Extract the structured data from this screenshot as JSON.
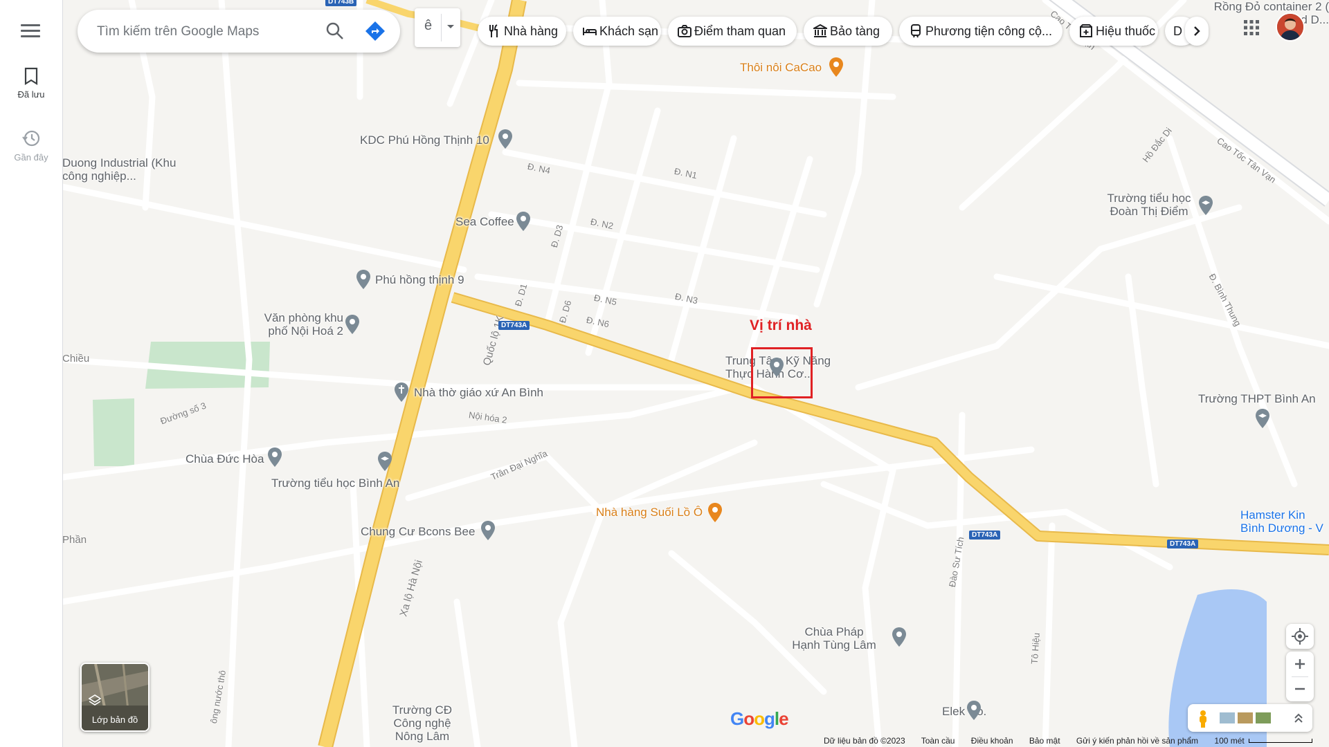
{
  "sidebar": {
    "items": [
      {
        "label": "Đã lưu"
      },
      {
        "label": "Gần đây"
      }
    ]
  },
  "search": {
    "placeholder": "Tìm kiếm trên Google Maps"
  },
  "language_button": {
    "label": "ê"
  },
  "chips": [
    {
      "label": "Nhà hàng"
    },
    {
      "label": "Khách sạn"
    },
    {
      "label": "Điểm tham quan"
    },
    {
      "label": "Bảo tàng"
    },
    {
      "label": "Phương tiện công cộ..."
    },
    {
      "label": "Hiệu thuốc"
    },
    {
      "label": "D"
    }
  ],
  "annotation": {
    "label": "Vị trí nhà",
    "color": "#e02124"
  },
  "places": [
    {
      "name": "Thôi nôi CaCao"
    },
    {
      "name": "KDC Phú Hồng Thịnh 10"
    },
    {
      "name": "Sea Coffee"
    },
    {
      "name": "Phú hồng thịnh 9"
    },
    {
      "name": "Văn phòng khu phố Nội Hoá 2"
    },
    {
      "name": "Nhà thờ giáo xứ An Bình"
    },
    {
      "name": "Chùa Đức Hòa"
    },
    {
      "name": "Trường tiểu học Bình An"
    },
    {
      "name": "Chung Cư Bcons Bee"
    },
    {
      "name": "Nhà hàng Suối Lồ Ô"
    },
    {
      "name": "Trung Tâm Kỹ Năng Thực Hành Cơ..."
    },
    {
      "name": "Trường tiểu học Đoàn Thị Điểm"
    },
    {
      "name": "Trường THPT Bình An"
    },
    {
      "name": "Hamster Kin Bình Dương - V"
    },
    {
      "name": "Chùa Pháp Hạnh Tùng Lâm"
    },
    {
      "name": "Elek Co."
    },
    {
      "name": "Trường CĐ Công nghệ Nông Lâm"
    },
    {
      "name": "Duong Industrial (Khu công nghiệp..."
    },
    {
      "name": "Rồng Đỏ container 2 ( Red D..."
    }
  ],
  "roads": [
    {
      "name": "Quốc lộ 1K"
    },
    {
      "name": "Xa lộ Hà Nội"
    },
    {
      "name": "Đ. N4"
    },
    {
      "name": "Đ. N1"
    },
    {
      "name": "Đ. N2"
    },
    {
      "name": "Đ. D3"
    },
    {
      "name": "Đ. D1"
    },
    {
      "name": "Đ. D6"
    },
    {
      "name": "Đ. N5"
    },
    {
      "name": "Đ. N6"
    },
    {
      "name": "Đ. N3"
    },
    {
      "name": "Nội hóa 2"
    },
    {
      "name": "Trần Đại Nghĩa"
    },
    {
      "name": "Đường số 3"
    },
    {
      "name": "Đào Sư Tích"
    },
    {
      "name": "Tô Hiệu"
    },
    {
      "name": "Hồ Đắc Di"
    },
    {
      "name": "Đ. Bình Thung"
    },
    {
      "name": "Cao Tốc Tân Vạn"
    },
    {
      "name": "Cao Tố... Vạn"
    },
    {
      "name": "Chiều"
    },
    {
      "name": "Phần"
    },
    {
      "name": "ông nước thô"
    }
  ],
  "route_shields": [
    "DT743A",
    "DT743A",
    "DT743A",
    "DT743B"
  ],
  "layers": {
    "label": "Lớp bản đồ"
  },
  "footer": {
    "data": "Dữ liệu bản đồ ©2023",
    "links": [
      "Toàn cầu",
      "Điều khoản",
      "Bảo mật",
      "Gửi ý kiến phản hồi về sản phẩm"
    ],
    "scale": "100 mét"
  },
  "logo": {
    "text": "Google"
  },
  "colors": {
    "highway": "#f9d56c",
    "highway_border": "#e8b94a",
    "road": "#ffffff",
    "park": "#c9e6cc",
    "water": "#a9c8f5",
    "map_bg": "#f5f4f1"
  }
}
